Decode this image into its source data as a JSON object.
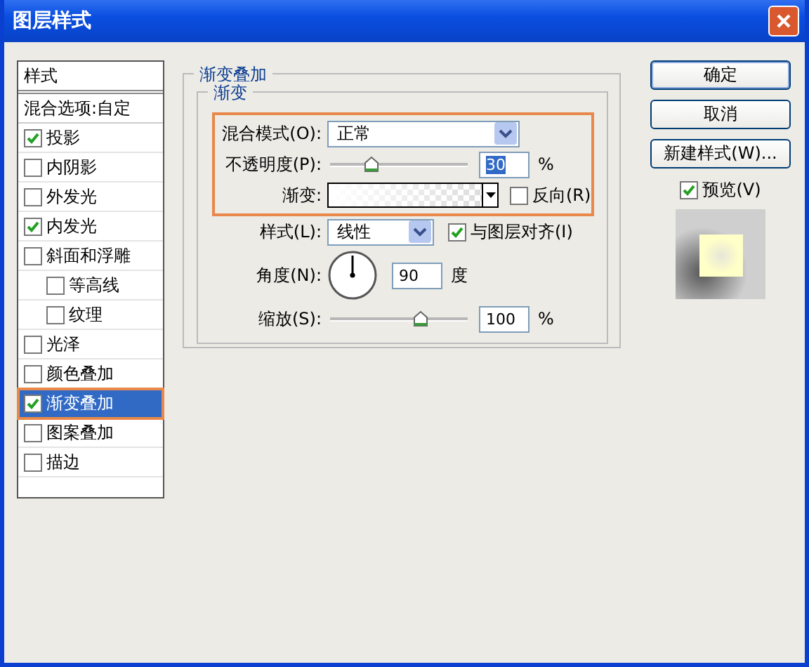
{
  "window": {
    "title": "图层样式"
  },
  "styles_panel": {
    "header": "样式",
    "blend_options": "混合选项:自定",
    "items": [
      {
        "label": "投影",
        "checked": true,
        "selected": false
      },
      {
        "label": "内阴影",
        "checked": false,
        "selected": false
      },
      {
        "label": "外发光",
        "checked": false,
        "selected": false
      },
      {
        "label": "内发光",
        "checked": true,
        "selected": false
      },
      {
        "label": "斜面和浮雕",
        "checked": false,
        "selected": false,
        "children": [
          {
            "label": "等高线",
            "checked": false,
            "selected": false
          },
          {
            "label": "纹理",
            "checked": false,
            "selected": false
          }
        ]
      },
      {
        "label": "光泽",
        "checked": false,
        "selected": false
      },
      {
        "label": "颜色叠加",
        "checked": false,
        "selected": false
      },
      {
        "label": "渐变叠加",
        "checked": true,
        "selected": true
      },
      {
        "label": "图案叠加",
        "checked": false,
        "selected": false
      },
      {
        "label": "描边",
        "checked": false,
        "selected": false
      }
    ]
  },
  "gradient_overlay": {
    "title": "渐变叠加",
    "group_title": "渐变",
    "blend_mode": {
      "label": "混合模式(O):",
      "value": "正常"
    },
    "opacity": {
      "label": "不透明度(P):",
      "level": 0.3,
      "value": "30",
      "unit": "%"
    },
    "gradient": {
      "label": "渐变:",
      "reverse": {
        "label": "反向(R)",
        "checked": false
      }
    },
    "style": {
      "label": "样式(L):",
      "value": "线性"
    },
    "align_with_layer": {
      "label": "与图层对齐(I)",
      "checked": true
    },
    "angle": {
      "label": "角度(N):",
      "value": "90",
      "unit": "度"
    },
    "scale": {
      "label": "缩放(S):",
      "level": 0.65,
      "value": "100",
      "unit": "%"
    }
  },
  "buttons": [
    {
      "label": "确定",
      "default": true
    },
    {
      "label": "取消",
      "default": false
    },
    {
      "label": "新建样式(W)...",
      "default": false
    }
  ],
  "preview": {
    "label": "预览(V)",
    "checked": true
  }
}
